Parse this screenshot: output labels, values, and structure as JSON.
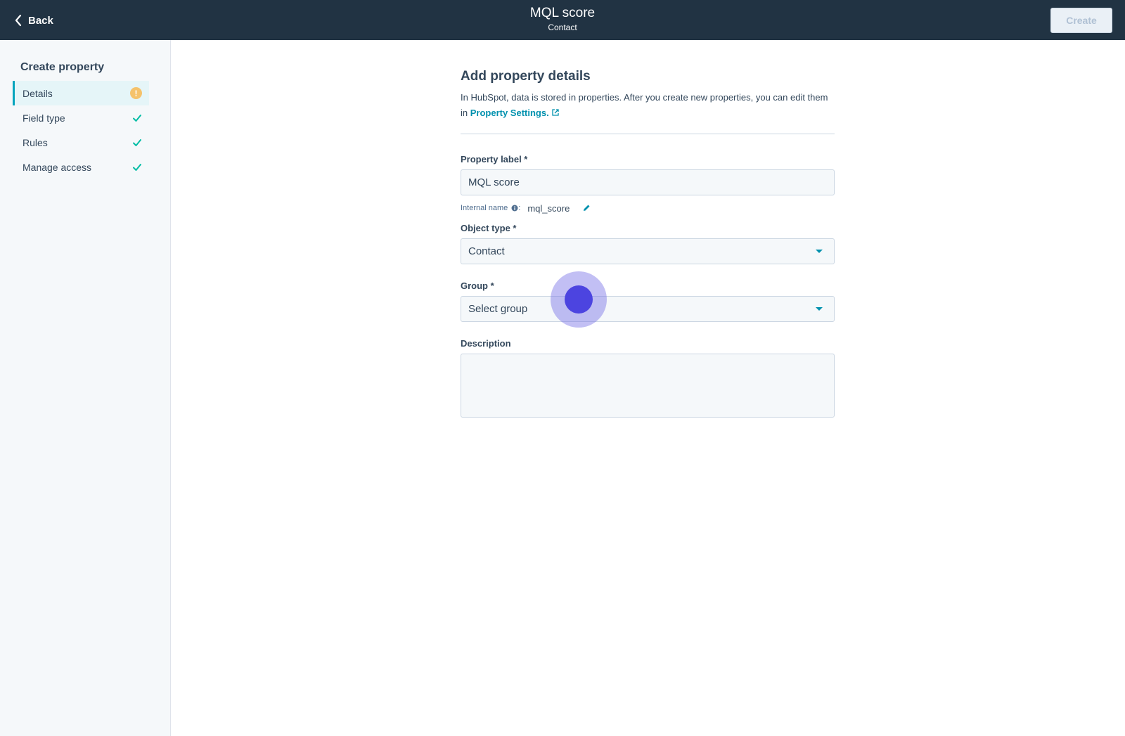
{
  "header": {
    "back_label": "Back",
    "title": "MQL score",
    "subtitle": "Contact",
    "create_label": "Create"
  },
  "sidebar": {
    "title": "Create property",
    "items": [
      {
        "label": "Details",
        "status": "warning",
        "icon": "warning-icon"
      },
      {
        "label": "Field type",
        "status": "complete",
        "icon": "check-icon"
      },
      {
        "label": "Rules",
        "status": "complete",
        "icon": "check-icon"
      },
      {
        "label": "Manage access",
        "status": "complete",
        "icon": "check-icon"
      }
    ]
  },
  "main": {
    "heading": "Add property details",
    "intro_text": "In HubSpot, data is stored in properties. After you create new properties, you can edit them in ",
    "intro_link": "Property Settings.",
    "property_label": {
      "label": "Property label *",
      "value": "MQL score"
    },
    "internal_name": {
      "label": "Internal name",
      "separator": ":",
      "value": "mql_score"
    },
    "object_type": {
      "label": "Object type *",
      "value": "Contact"
    },
    "group": {
      "label": "Group *",
      "value": "Select group"
    },
    "description": {
      "label": "Description",
      "value": ""
    }
  },
  "colors": {
    "topbar": "#213343",
    "accent": "#0091ae",
    "warning": "#f5c26b",
    "success": "#00bda5",
    "cursor": "#4c44e0"
  }
}
